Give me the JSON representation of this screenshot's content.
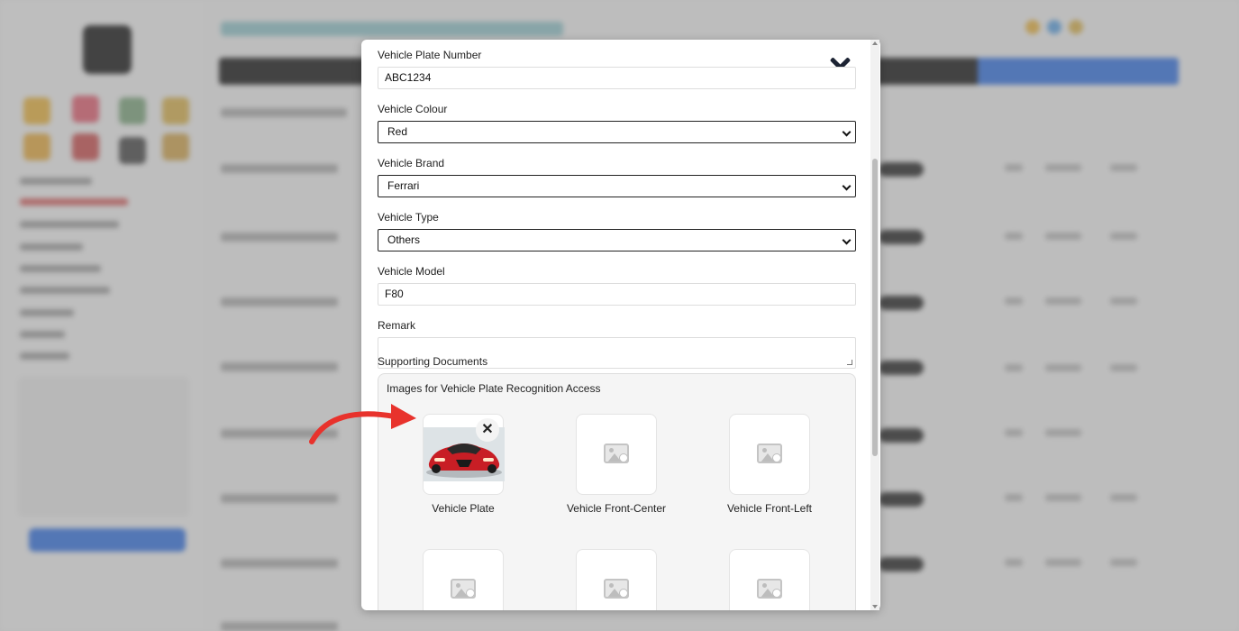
{
  "form": {
    "plate": {
      "label": "Vehicle Plate Number",
      "value": "ABC1234"
    },
    "colour": {
      "label": "Vehicle Colour",
      "value": "Red"
    },
    "brand": {
      "label": "Vehicle Brand",
      "value": "Ferrari"
    },
    "type": {
      "label": "Vehicle Type",
      "value": "Others"
    },
    "model": {
      "label": "Vehicle Model",
      "value": "F80"
    },
    "remark": {
      "label": "Remark",
      "value": ""
    }
  },
  "documents": {
    "heading": "Supporting Documents",
    "box_title": "Images for Vehicle Plate Recognition Access",
    "slots": [
      {
        "caption": "Vehicle Plate",
        "has_image": true
      },
      {
        "caption": "Vehicle Front-Center",
        "has_image": false
      },
      {
        "caption": "Vehicle Front-Left",
        "has_image": false
      }
    ]
  },
  "icons": {
    "close": "close-icon",
    "remove": "remove-image-icon",
    "placeholder": "add-photo-icon",
    "annotation": "red-curved-arrow-icon"
  },
  "colors": {
    "annotation_arrow": "#e8322c",
    "close_icon": "#1c2333"
  }
}
